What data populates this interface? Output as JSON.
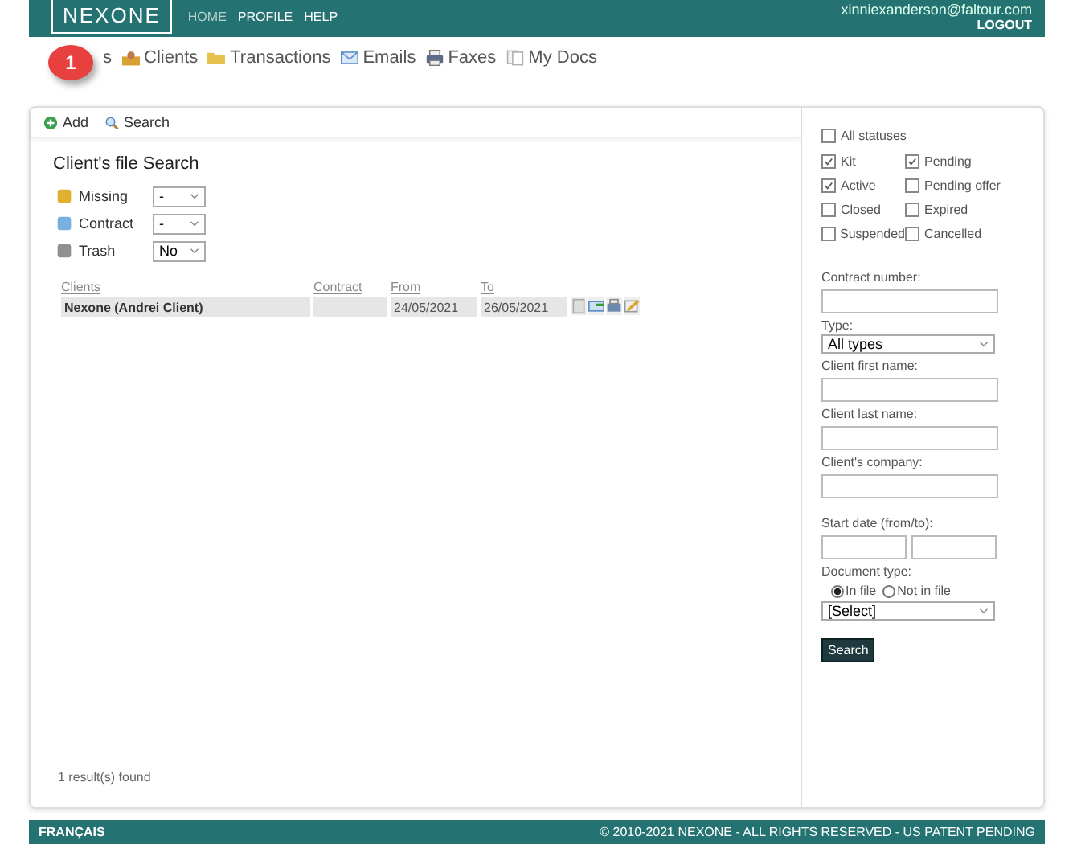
{
  "header": {
    "logo": "NEXONE",
    "menu": [
      {
        "label": "HOME",
        "selected": true
      },
      {
        "label": "PROFILE",
        "selected": false
      },
      {
        "label": "HELP",
        "selected": false
      }
    ],
    "user_email": "xinniexanderson@faltour.com",
    "logout": "LOGOUT"
  },
  "nav": [
    {
      "label": "s"
    },
    {
      "label": "Clients"
    },
    {
      "label": "Transactions"
    },
    {
      "label": "Emails"
    },
    {
      "label": "Faxes"
    },
    {
      "label": "My Docs"
    }
  ],
  "step_badge": "1",
  "toolbar": [
    {
      "label": "Add"
    },
    {
      "label": "Search"
    }
  ],
  "title": "Client's file Search",
  "filters": [
    {
      "label": "Missing",
      "value": "-"
    },
    {
      "label": "Contract",
      "value": "-"
    },
    {
      "label": "Trash",
      "value": "No"
    }
  ],
  "table": {
    "columns": [
      "Clients",
      "Contract",
      "From",
      "To"
    ],
    "rows": [
      {
        "client": "Nexone (Andrei Client)",
        "contract": "",
        "from": "24/05/2021",
        "to": "26/05/2021"
      }
    ]
  },
  "result_count": "1 result(s) found",
  "statuses": {
    "all": {
      "label": "All statuses",
      "checked": false
    },
    "items": [
      {
        "label": "Kit",
        "checked": true
      },
      {
        "label": "Pending",
        "checked": true
      },
      {
        "label": "Active",
        "checked": true
      },
      {
        "label": "Pending offer",
        "checked": false
      },
      {
        "label": "Closed",
        "checked": false
      },
      {
        "label": "Expired",
        "checked": false
      },
      {
        "label": "Suspended",
        "checked": false
      },
      {
        "label": "Cancelled",
        "checked": false
      }
    ]
  },
  "form": {
    "contract_number": "Contract number:",
    "type_label": "Type:",
    "type_value": "All types",
    "first_name": "Client first name:",
    "last_name": "Client last name:",
    "company": "Client's company:",
    "start_date": "Start date (from/to):",
    "doc_type": "Document type:",
    "doc_options": [
      {
        "label": "In file",
        "selected": true
      },
      {
        "label": "Not in file",
        "selected": false
      }
    ],
    "doc_value": "[Select]",
    "search_button": "Search"
  },
  "footer": {
    "language": "FRANÇAIS",
    "copyright": "© 2010-2021 NEXONE - ALL RIGHTS RESERVED - US PATENT PENDING"
  }
}
